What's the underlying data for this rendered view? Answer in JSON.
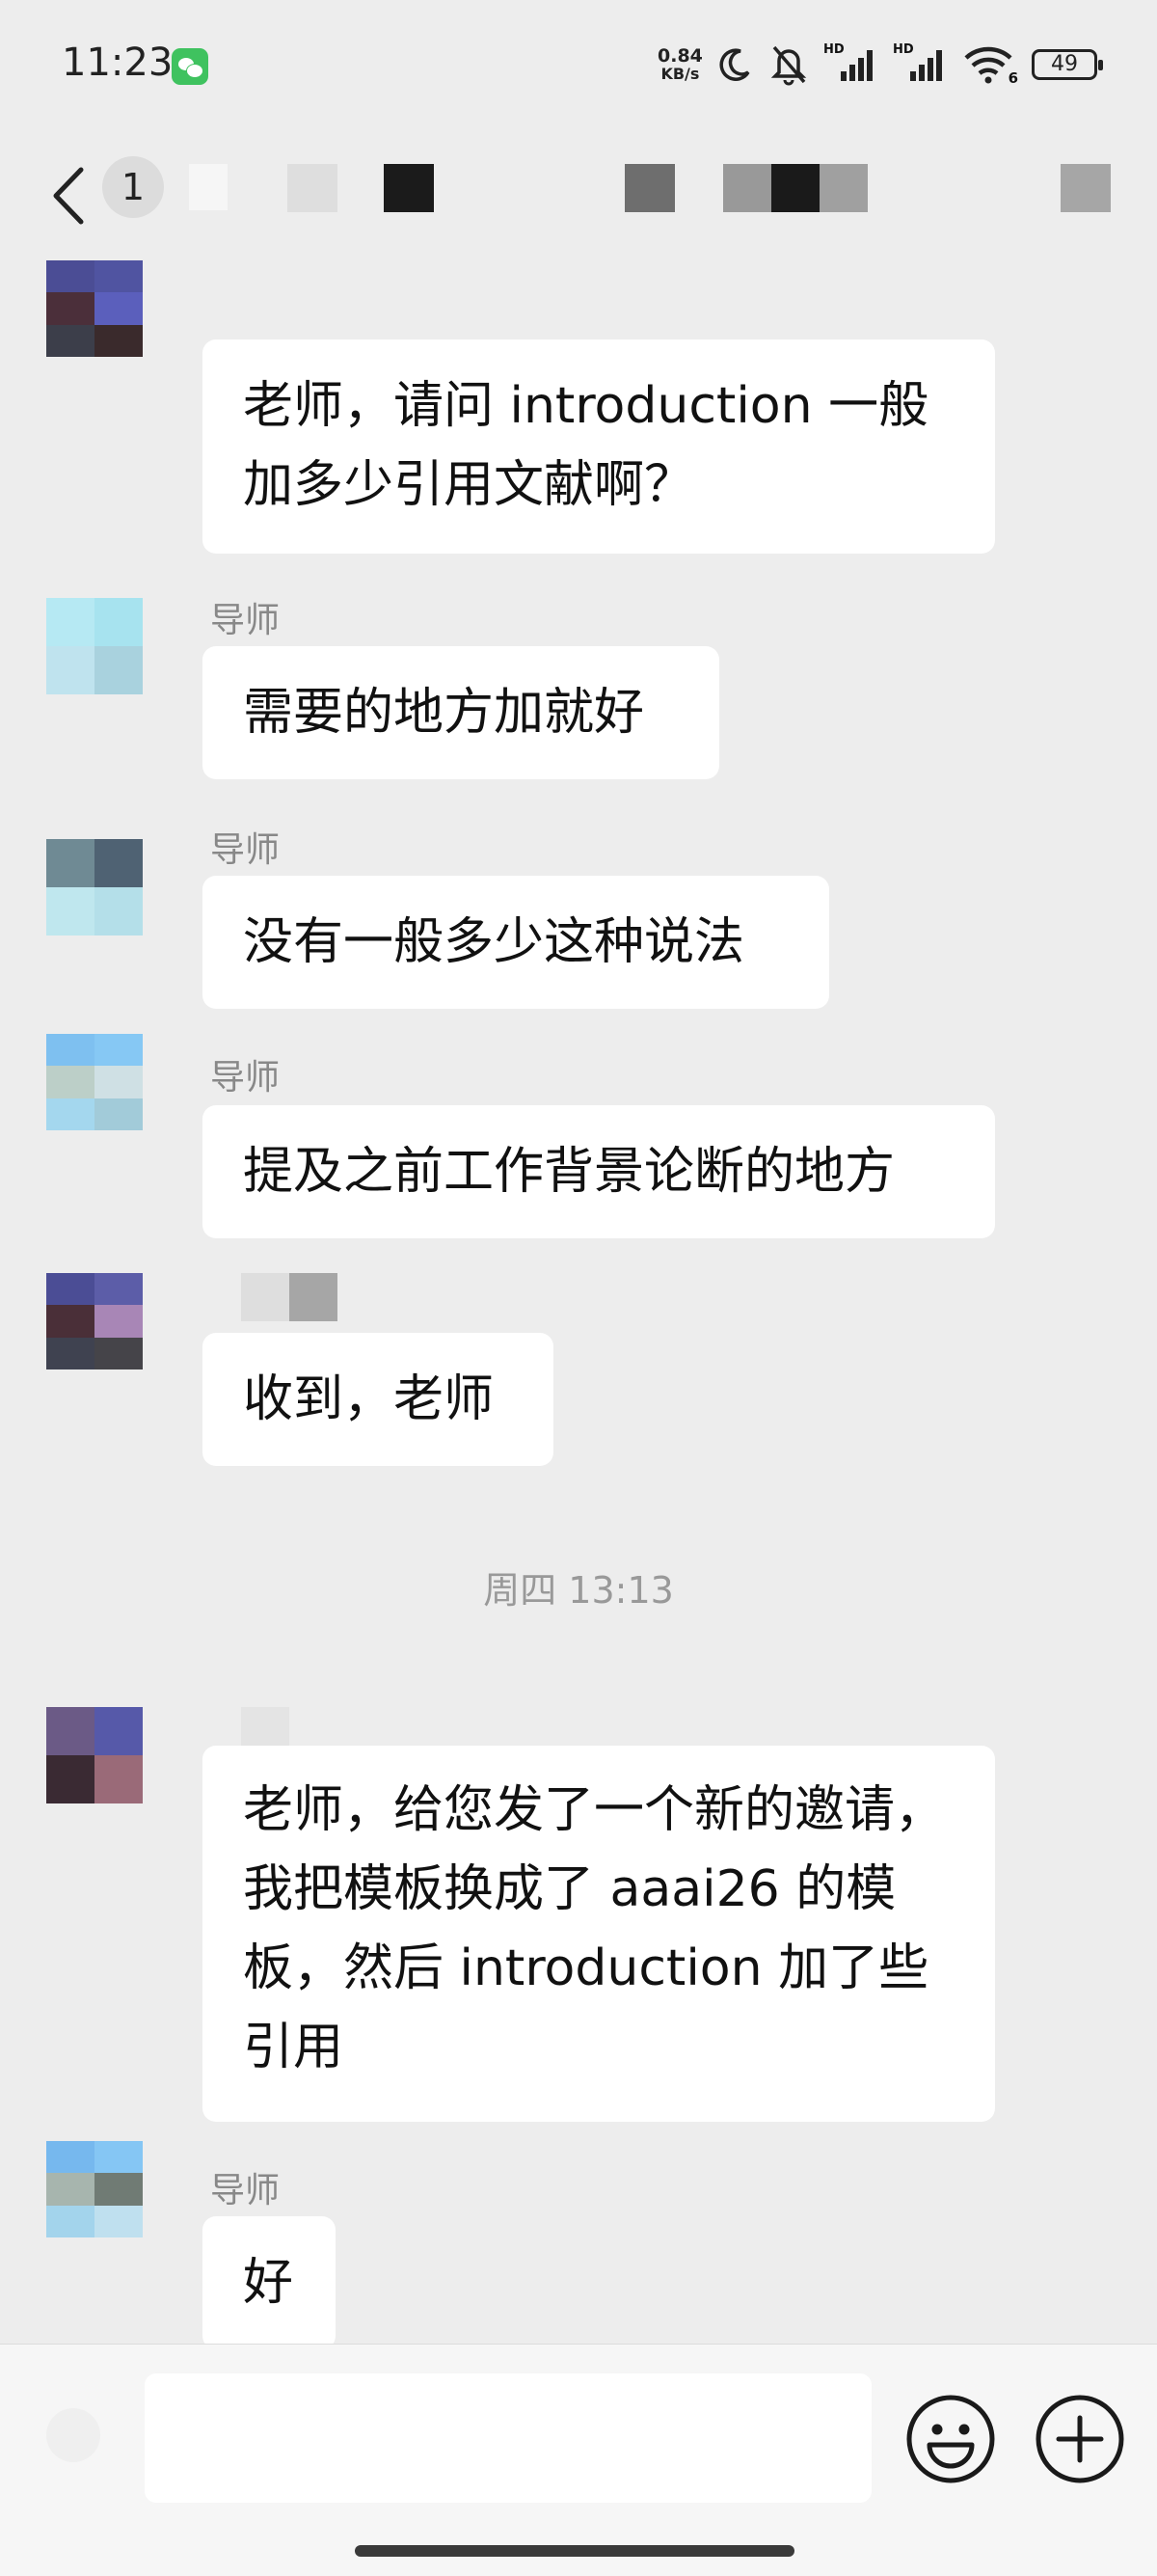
{
  "status_bar": {
    "time": "11:23",
    "net_speed_value": "0.84",
    "net_speed_unit": "KB/s",
    "signal_label_1": "HD",
    "signal_label_2": "HD",
    "wifi_label": "6",
    "battery_level": "49",
    "notification_app_icon": "wechat-icon"
  },
  "nav": {
    "unread_badge": "1"
  },
  "messages": [
    {
      "text_lines": [
        "老师，请问 introduction 一般",
        "加多少引用文献啊？"
      ]
    },
    {
      "sender": "导师",
      "text_lines": [
        "需要的地方加就好"
      ]
    },
    {
      "sender": "导师",
      "text_lines": [
        "没有一般多少这种说法"
      ]
    },
    {
      "sender": "导师",
      "text_lines": [
        "提及之前工作背景论断的地方"
      ]
    },
    {
      "text_lines": [
        "收到，老师"
      ]
    },
    {
      "text_lines": [
        "老师，给您发了一个新的邀请，",
        "我把模板换成了 aaai26 的模",
        "板，然后 introduction 加了些",
        "引用"
      ]
    },
    {
      "sender": "导师",
      "text_lines": [
        "好"
      ]
    }
  ],
  "timestamp_divider": "周四 13:13",
  "input_bar": {
    "text_value": "",
    "emoji_icon": "emoji-icon",
    "plus_icon": "plus-icon"
  },
  "colors": {
    "background": "#ededed",
    "bubble": "#ffffff",
    "timestamp_text": "#999999",
    "sender_text": "#888888",
    "wechat_green": "#3fc25f"
  }
}
